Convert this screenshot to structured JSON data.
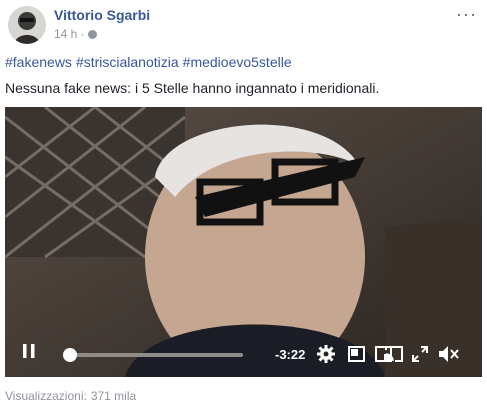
{
  "post": {
    "author": "Vittorio Sgarbi",
    "time": "14 h",
    "separator": "·",
    "more_label": "···",
    "hashtags": [
      "#fakenews",
      "#striscialanotizia",
      "#medioevo5stelle"
    ],
    "text": "Nessuna fake news: i 5 Stelle hanno ingannato i meridionali."
  },
  "video": {
    "time_remaining": "-3:22",
    "progress": 0.03
  },
  "footer": {
    "views_label": "Visualizzazioni:",
    "views_count": "371 mila"
  },
  "icons": {
    "avatar": "avatar",
    "globe": "globe-icon",
    "more": "more-icon",
    "pause": "pause-icon",
    "settings": "gear-icon",
    "pip": "picture-in-picture-icon",
    "theater": "theater-mode-icon",
    "cast": "cast-icon",
    "fullscreen": "fullscreen-icon",
    "volume": "volume-muted-icon"
  },
  "colors": {
    "link": "#385898",
    "meta": "#90949c",
    "text": "#1d2129"
  }
}
